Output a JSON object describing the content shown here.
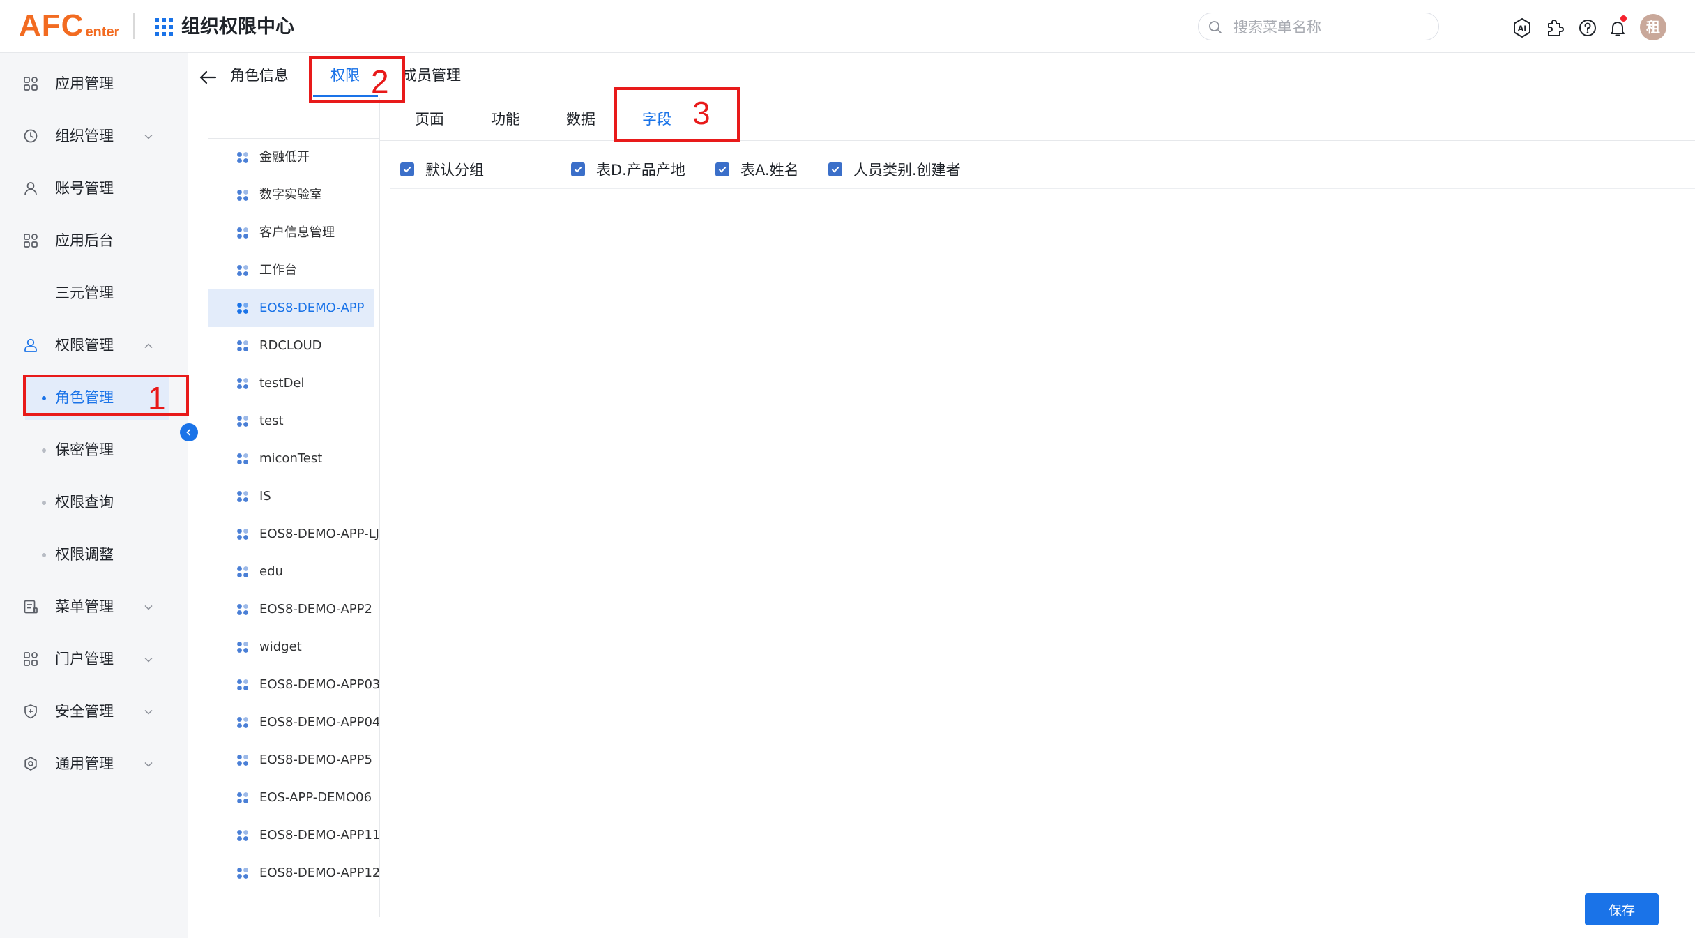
{
  "header": {
    "logo_big": "AFC",
    "logo_small": "enter",
    "app_title": "组织权限中心",
    "search_placeholder": "搜索菜单名称",
    "icons": [
      "ai-icon",
      "plugin-icon",
      "help-icon",
      "bell-icon"
    ],
    "avatar_text": "租"
  },
  "sidebar": {
    "items": [
      {
        "label": "应用管理",
        "icon": "grid-icon"
      },
      {
        "label": "组织管理",
        "icon": "clock-icon",
        "expandable": true
      },
      {
        "label": "账号管理",
        "icon": "user-icon"
      },
      {
        "label": "应用后台",
        "icon": "grid-icon"
      },
      {
        "label": "三元管理",
        "icon": ""
      },
      {
        "label": "权限管理",
        "icon": "person-lock-icon",
        "expanded": true
      },
      {
        "label": "角色管理",
        "sub": true,
        "active": true
      },
      {
        "label": "保密管理",
        "sub": true
      },
      {
        "label": "权限查询",
        "sub": true
      },
      {
        "label": "权限调整",
        "sub": true
      },
      {
        "label": "菜单管理",
        "icon": "menu-doc-icon",
        "expandable": true
      },
      {
        "label": "门户管理",
        "icon": "grid-icon",
        "expandable": true
      },
      {
        "label": "安全管理",
        "icon": "shield-icon",
        "expandable": true
      },
      {
        "label": "通用管理",
        "icon": "settings-icon",
        "expandable": true
      }
    ]
  },
  "top_tabs": [
    {
      "label": "角色信息"
    },
    {
      "label": "权限",
      "active": true
    },
    {
      "label": "成员管理"
    }
  ],
  "app_list": [
    "金融低开",
    "数字实验室",
    "客户信息管理",
    "工作台",
    "EOS8-DEMO-APP",
    "RDCLOUD",
    "testDel",
    "test",
    "miconTest",
    "IS",
    "EOS8-DEMO-APP-LJ",
    "edu",
    "EOS8-DEMO-APP2",
    "widget",
    "EOS8-DEMO-APP03",
    "EOS8-DEMO-APP04",
    "EOS8-DEMO-APP5",
    "EOS-APP-DEMO06",
    "EOS8-DEMO-APP11",
    "EOS8-DEMO-APP12"
  ],
  "app_list_selected": "EOS8-DEMO-APP",
  "sub_tabs": [
    {
      "label": "页面"
    },
    {
      "label": "功能"
    },
    {
      "label": "数据"
    },
    {
      "label": "字段",
      "active": true
    }
  ],
  "fields": [
    {
      "label": "默认分组",
      "checked": true
    },
    {
      "label": "表D.产品产地",
      "checked": true
    },
    {
      "label": "表A.姓名",
      "checked": true
    },
    {
      "label": "人员类别.创建者",
      "checked": true
    }
  ],
  "save_label": "保存",
  "annotations": [
    "1",
    "2",
    "3"
  ],
  "colors": {
    "accent": "#1a73e8",
    "logo": "#f26b21",
    "annotation": "#e81a1a",
    "checkbox": "#3b6fc9"
  }
}
